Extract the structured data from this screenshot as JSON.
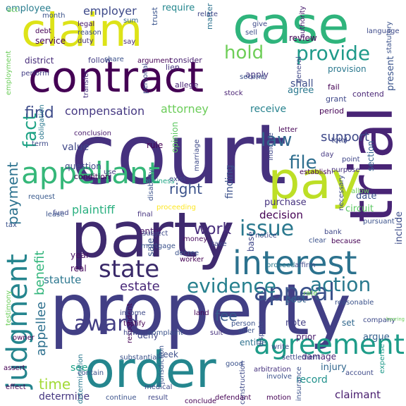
{
  "words": [
    {
      "text": "court",
      "color": "#46317e",
      "vertical": false
    },
    {
      "text": "property",
      "color": "#423f85",
      "vertical": false
    },
    {
      "text": "contract",
      "color": "#440154",
      "vertical": false
    },
    {
      "text": "party",
      "color": "#3f2a6f",
      "vertical": false
    },
    {
      "text": "case",
      "color": "#2fb47c",
      "vertical": false
    },
    {
      "text": "claim",
      "color": "#dde318",
      "vertical": false
    },
    {
      "text": "pay",
      "color": "#bddf26",
      "vertical": false
    },
    {
      "text": "trial",
      "color": "#482475",
      "vertical": true
    },
    {
      "text": "order",
      "color": "#24868e",
      "vertical": false
    },
    {
      "text": "appellant",
      "color": "#35b779",
      "vertical": false
    },
    {
      "text": "interest",
      "color": "#2c728e",
      "vertical": false
    },
    {
      "text": "agreement",
      "color": "#1e9c89",
      "vertical": false
    },
    {
      "text": "judgment",
      "color": "#25858e",
      "vertical": true
    },
    {
      "text": "appeal",
      "color": "#3b528b",
      "vertical": false
    },
    {
      "text": "state",
      "color": "#3a2a6a",
      "vertical": false
    },
    {
      "text": "award",
      "color": "#433e85",
      "vertical": false
    },
    {
      "text": "issue",
      "color": "#2a788e",
      "vertical": false
    },
    {
      "text": "evidence",
      "color": "#27808e",
      "vertical": false
    },
    {
      "text": "action",
      "color": "#29798e",
      "vertical": false
    },
    {
      "text": "provide",
      "color": "#1f9a8a",
      "vertical": false
    },
    {
      "text": "hold",
      "color": "#6ece58",
      "vertical": false
    },
    {
      "text": "fact",
      "color": "#20a386",
      "vertical": true
    },
    {
      "text": "file",
      "color": "#2e6e8e",
      "vertical": false
    },
    {
      "text": "law",
      "color": "#31688e",
      "vertical": false
    },
    {
      "text": "find",
      "color": "#3e4c8a",
      "vertical": false
    },
    {
      "text": "work",
      "color": "#472d7b",
      "vertical": false
    },
    {
      "text": "right",
      "color": "#3b528b",
      "vertical": false
    },
    {
      "text": "fee",
      "color": "#38598c",
      "vertical": false
    },
    {
      "text": "time",
      "color": "#a2da37",
      "vertical": false
    },
    {
      "text": "estate",
      "color": "#482878",
      "vertical": false
    },
    {
      "text": "payment",
      "color": "#2c728e",
      "vertical": true
    },
    {
      "text": "benefit",
      "color": "#31b57b",
      "vertical": true
    },
    {
      "text": "appellee",
      "color": "#2d708e",
      "vertical": true
    },
    {
      "text": "support",
      "color": "#3e4989",
      "vertical": false
    },
    {
      "text": "employer",
      "color": "#3e4a89",
      "vertical": false
    },
    {
      "text": "compensation",
      "color": "#453882",
      "vertical": false
    },
    {
      "text": "attorney",
      "color": "#6ccd5a",
      "vertical": false
    },
    {
      "text": "plaintiff",
      "color": "#29af7f",
      "vertical": false
    },
    {
      "text": "statute",
      "color": "#2a768e",
      "vertical": false
    },
    {
      "text": "cost",
      "color": "#33628d",
      "vertical": false
    },
    {
      "text": "claimant",
      "color": "#481c6e",
      "vertical": false
    },
    {
      "text": "determine",
      "color": "#453781",
      "vertical": false
    },
    {
      "text": "decision",
      "color": "#440154",
      "vertical": false
    },
    {
      "text": "receive",
      "color": "#26828e",
      "vertical": false
    },
    {
      "text": "finding",
      "color": "#3b518b",
      "vertical": true
    },
    {
      "text": "value",
      "color": "#3f4788",
      "vertical": false
    },
    {
      "text": "employee",
      "color": "#287c8e",
      "vertical": false
    },
    {
      "text": "require",
      "color": "#24878e",
      "vertical": false
    },
    {
      "text": "shall",
      "color": "#3d4e8a",
      "vertical": false
    },
    {
      "text": "agree",
      "color": "#2a788e",
      "vertical": false
    },
    {
      "text": "record",
      "color": "#21918c",
      "vertical": false
    },
    {
      "text": "injury",
      "color": "#31688e",
      "vertical": false
    },
    {
      "text": "see",
      "color": "#1fa088",
      "vertical": false
    },
    {
      "text": "note",
      "color": "#423f85",
      "vertical": false
    },
    {
      "text": "argue",
      "color": "#34608d",
      "vertical": false
    },
    {
      "text": "date",
      "color": "#3b528b",
      "vertical": false
    },
    {
      "text": "circuit",
      "color": "#5cc863",
      "vertical": false
    },
    {
      "text": "include",
      "color": "#3d4d8a",
      "vertical": true
    },
    {
      "text": "section",
      "color": "#33628d",
      "vertical": true
    },
    {
      "text": "present",
      "color": "#3a548c",
      "vertical": true
    },
    {
      "text": "sale",
      "color": "#3b528b",
      "vertical": true
    },
    {
      "text": "rule",
      "color": "#440154",
      "vertical": false
    },
    {
      "text": "base",
      "color": "#3f4788",
      "vertical": true
    },
    {
      "text": "opinion",
      "color": "#5ec962",
      "vertical": true
    },
    {
      "text": "purchase",
      "color": "#46337f",
      "vertical": false
    },
    {
      "text": "enter",
      "color": "#481769",
      "vertical": false
    },
    {
      "text": "year",
      "color": "#471164",
      "vertical": false
    },
    {
      "text": "real",
      "color": "#46085c",
      "vertical": false
    },
    {
      "text": "set",
      "color": "#31688e",
      "vertical": false
    },
    {
      "text": "prior",
      "color": "#481a6c",
      "vertical": false
    },
    {
      "text": "damage",
      "color": "#482475",
      "vertical": false
    },
    {
      "text": "entitle",
      "color": "#2d718e",
      "vertical": false
    },
    {
      "text": "question",
      "color": "#3f4788",
      "vertical": false
    },
    {
      "text": "review",
      "color": "#440154",
      "vertical": false
    },
    {
      "text": "apply",
      "color": "#453781",
      "vertical": false
    },
    {
      "text": "provision",
      "color": "#2a788e",
      "vertical": false
    },
    {
      "text": "seek",
      "color": "#3c4f8a",
      "vertical": false
    },
    {
      "text": "deny",
      "color": "#404688",
      "vertical": false
    },
    {
      "text": "fail",
      "color": "#440154",
      "vertical": false
    },
    {
      "text": "contend",
      "color": "#482475",
      "vertical": false
    },
    {
      "text": "grant",
      "color": "#3f4889",
      "vertical": false
    },
    {
      "text": "period",
      "color": "#440154",
      "vertical": false
    },
    {
      "text": "service",
      "color": "#440154",
      "vertical": false
    },
    {
      "text": "district",
      "color": "#472c7a",
      "vertical": false
    },
    {
      "text": "follow",
      "color": "#433e85",
      "vertical": false
    },
    {
      "text": "consider",
      "color": "#482071",
      "vertical": false
    },
    {
      "text": "lien",
      "color": "#46327e",
      "vertical": false
    },
    {
      "text": "allege",
      "color": "#482475",
      "vertical": false
    },
    {
      "text": "trust",
      "color": "#3a548c",
      "vertical": true
    },
    {
      "text": "matter",
      "color": "#2c728e",
      "vertical": true
    },
    {
      "text": "condition",
      "color": "#440154",
      "vertical": false
    },
    {
      "text": "conclusion",
      "color": "#481a6c",
      "vertical": false
    },
    {
      "text": "term",
      "color": "#3e4a89",
      "vertical": false
    },
    {
      "text": "request",
      "color": "#38598c",
      "vertical": false
    },
    {
      "text": "business",
      "color": "#21a685",
      "vertical": false
    },
    {
      "text": "fund",
      "color": "#3f4788",
      "vertical": false
    },
    {
      "text": "final",
      "color": "#46337f",
      "vertical": false
    },
    {
      "text": "statutory",
      "color": "#3b528b",
      "vertical": true
    },
    {
      "text": "authority",
      "color": "#481c6e",
      "vertical": true
    },
    {
      "text": "language",
      "color": "#3e4a89",
      "vertical": false
    },
    {
      "text": "legal",
      "color": "#481a6c",
      "vertical": false
    },
    {
      "text": "reason",
      "color": "#3d4d8a",
      "vertical": false
    },
    {
      "text": "duty",
      "color": "#46307e",
      "vertical": false
    },
    {
      "text": "sum",
      "color": "#32648e",
      "vertical": false
    },
    {
      "text": "say",
      "color": "#482878",
      "vertical": false
    },
    {
      "text": "give",
      "color": "#3e4a89",
      "vertical": false
    },
    {
      "text": "sell",
      "color": "#3d4e8a",
      "vertical": false
    },
    {
      "text": "stock",
      "color": "#482173",
      "vertical": false
    },
    {
      "text": "month",
      "color": "#3b528b",
      "vertical": false
    },
    {
      "text": "relate",
      "color": "#3f4788",
      "vertical": false
    },
    {
      "text": "debt",
      "color": "#440154",
      "vertical": false
    },
    {
      "text": "argument",
      "color": "#440154",
      "vertical": false
    },
    {
      "text": "share",
      "color": "#3b528b",
      "vertical": false
    },
    {
      "text": "perform",
      "color": "#433e85",
      "vertical": false
    },
    {
      "text": "employment",
      "color": "#6ccd5a",
      "vertical": true
    },
    {
      "text": "transfer",
      "color": "#46327e",
      "vertical": true
    },
    {
      "text": "personal",
      "color": "#3e4a89",
      "vertical": true
    },
    {
      "text": "general",
      "color": "#3f4788",
      "vertical": true
    },
    {
      "text": "second",
      "color": "#3b528b",
      "vertical": false
    },
    {
      "text": "obligation",
      "color": "#2a788e",
      "vertical": true
    },
    {
      "text": "establish",
      "color": "#440154",
      "vertical": false
    },
    {
      "text": "purpose",
      "color": "#46327e",
      "vertical": false
    },
    {
      "text": "point",
      "color": "#3f4788",
      "vertical": false
    },
    {
      "text": "allow",
      "color": "#6ccd5a",
      "vertical": false
    },
    {
      "text": "letter",
      "color": "#440154",
      "vertical": false
    },
    {
      "text": "day",
      "color": "#453882",
      "vertical": false
    },
    {
      "text": "necessary",
      "color": "#3e4a89",
      "vertical": true
    },
    {
      "text": "total",
      "color": "#3e4a89",
      "vertical": false
    },
    {
      "text": "indicate",
      "color": "#3f4788",
      "vertical": true
    },
    {
      "text": "use",
      "color": "#453781",
      "vertical": false
    },
    {
      "text": "exist",
      "color": "#3f4788",
      "vertical": false
    },
    {
      "text": "disability",
      "color": "#3b528b",
      "vertical": true
    },
    {
      "text": "marriage",
      "color": "#3e4a89",
      "vertical": true
    },
    {
      "text": "lease",
      "color": "#3b528b",
      "vertical": false
    },
    {
      "text": "tax",
      "color": "#3b528b",
      "vertical": false
    },
    {
      "text": "proceeding",
      "color": "#fde725",
      "vertical": false
    },
    {
      "text": "subject",
      "color": "#3e4a89",
      "vertical": false
    },
    {
      "text": "money",
      "color": "#46085c",
      "vertical": false
    },
    {
      "text": "take",
      "color": "#3f4788",
      "vertical": false
    },
    {
      "text": "mortgage",
      "color": "#3b528b",
      "vertical": false
    },
    {
      "text": "worker",
      "color": "#440154",
      "vertical": false
    },
    {
      "text": "decree",
      "color": "#3b528b",
      "vertical": false
    },
    {
      "text": "proceed",
      "color": "#2a788e",
      "vertical": false
    },
    {
      "text": "affirm",
      "color": "#3e4a89",
      "vertical": false
    },
    {
      "text": "notice",
      "color": "#3e4a89",
      "vertical": false
    },
    {
      "text": "clear",
      "color": "#3b528b",
      "vertical": false
    },
    {
      "text": "bank",
      "color": "#3f4788",
      "vertical": false
    },
    {
      "text": "because",
      "color": "#440154",
      "vertical": false
    },
    {
      "text": "pursuant",
      "color": "#3b528b",
      "vertical": false
    },
    {
      "text": "rate",
      "color": "#6ccd5a",
      "vertical": false
    },
    {
      "text": "reasonable",
      "color": "#3b528b",
      "vertical": false
    },
    {
      "text": "company",
      "color": "#3e4a89",
      "vertical": false
    },
    {
      "text": "hearing",
      "color": "#6ccd5a",
      "vertical": false
    },
    {
      "text": "expense",
      "color": "#1f9a8a",
      "vertical": true
    },
    {
      "text": "person",
      "color": "#3b528b",
      "vertical": false
    },
    {
      "text": "dispute",
      "color": "#3e4a89",
      "vertical": true
    },
    {
      "text": "respondent",
      "color": "#440154",
      "vertical": true
    },
    {
      "text": "income",
      "color": "#3e4a89",
      "vertical": false
    },
    {
      "text": "testify",
      "color": "#440154",
      "vertical": false
    },
    {
      "text": "however",
      "color": "#3f4788",
      "vertical": false
    },
    {
      "text": "complaint",
      "color": "#3b528b",
      "vertical": false
    },
    {
      "text": "land",
      "color": "#440154",
      "vertical": false
    },
    {
      "text": "suit",
      "color": "#46327e",
      "vertical": false
    },
    {
      "text": "jurisdiction",
      "color": "#3b528b",
      "vertical": true
    },
    {
      "text": "owner",
      "color": "#440154",
      "vertical": false
    },
    {
      "text": "testimony",
      "color": "#6ccd5a",
      "vertical": true
    },
    {
      "text": "determination",
      "color": "#2a788e",
      "vertical": true
    },
    {
      "text": "substantial",
      "color": "#3b528b",
      "vertical": false
    },
    {
      "text": "arbitration",
      "color": "#46327e",
      "vertical": false
    },
    {
      "text": "write",
      "color": "#3e4a89",
      "vertical": false
    },
    {
      "text": "settlement",
      "color": "#3f4788",
      "vertical": false
    },
    {
      "text": "involve",
      "color": "#3b528b",
      "vertical": false
    },
    {
      "text": "assert",
      "color": "#440154",
      "vertical": false
    },
    {
      "text": "contain",
      "color": "#3b528b",
      "vertical": false
    },
    {
      "text": "effect",
      "color": "#440154",
      "vertical": false
    },
    {
      "text": "medical",
      "color": "#3e4a89",
      "vertical": false
    },
    {
      "text": "good",
      "color": "#3b528b",
      "vertical": false
    },
    {
      "text": "construction",
      "color": "#3e4a89",
      "vertical": true
    },
    {
      "text": "insurance",
      "color": "#3b528b",
      "vertical": true
    },
    {
      "text": "account",
      "color": "#3e4a89",
      "vertical": false
    },
    {
      "text": "continue",
      "color": "#3b528b",
      "vertical": false
    },
    {
      "text": "result",
      "color": "#3f4788",
      "vertical": false
    },
    {
      "text": "defendant",
      "color": "#440154",
      "vertical": false
    },
    {
      "text": "motion",
      "color": "#440154",
      "vertical": false
    },
    {
      "text": "conclude",
      "color": "#440154",
      "vertical": false
    },
    {
      "text": "offer",
      "color": "#3b528b",
      "vertical": false
    },
    {
      "text": "act",
      "color": "#6ccd5a",
      "vertical": false
    }
  ]
}
